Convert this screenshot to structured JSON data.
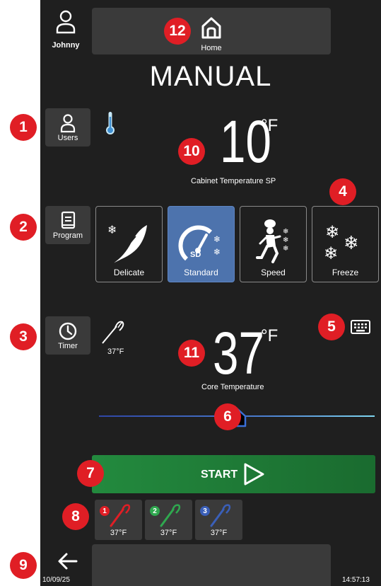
{
  "user": {
    "name": "Johnny"
  },
  "header": {
    "home_label": "Home"
  },
  "mode_title": "MANUAL",
  "side": {
    "users_label": "Users",
    "program_label": "Program",
    "timer_label": "Timer"
  },
  "cabinet": {
    "value": "10",
    "unit": "°F",
    "label": "Cabinet Temperature SP"
  },
  "programs": [
    {
      "label": "Delicate",
      "icon": "feather-snowflake-icon"
    },
    {
      "label": "Standard",
      "icon": "gauge-sd-icon",
      "badge": "SD",
      "selected": true
    },
    {
      "label": "Speed",
      "icon": "chef-running-icon"
    },
    {
      "label": "Freeze",
      "icon": "snowflakes-icon"
    }
  ],
  "probe_reading": "37°F",
  "core": {
    "value": "37",
    "unit": "°F",
    "label": "Core Temperature"
  },
  "slider": {
    "position_fraction": 0.5
  },
  "start": {
    "label": "START"
  },
  "probes": [
    {
      "num": "1",
      "temp": "37°F",
      "color": "#e01e25"
    },
    {
      "num": "2",
      "temp": "37°F",
      "color": "#2fa84f"
    },
    {
      "num": "3",
      "temp": "37°F",
      "color": "#3a5fb8"
    }
  ],
  "footer": {
    "date": "10/09/25",
    "time": "14:57:13"
  },
  "callouts": [
    "1",
    "2",
    "3",
    "4",
    "5",
    "6",
    "7",
    "8",
    "9",
    "10",
    "11",
    "12"
  ],
  "colors": {
    "accent_blue": "#4d73ad",
    "start_green": "#1e7a35",
    "callout_red": "#e01e25"
  }
}
